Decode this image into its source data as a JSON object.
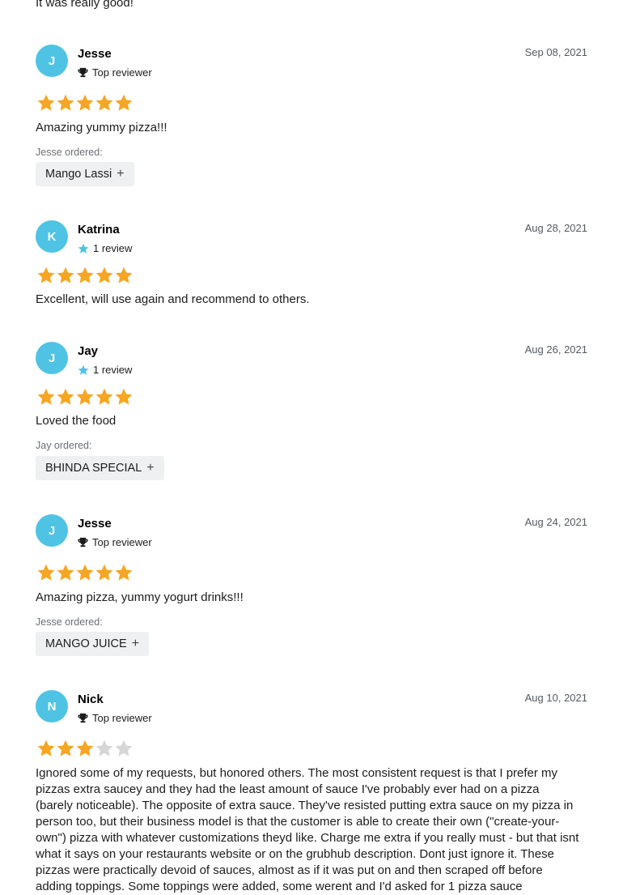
{
  "top_review_text": "It was really good!",
  "colors": {
    "avatar": "#4fc3e4",
    "star_filled": "#f6a623",
    "star_empty": "#d6d6d6"
  },
  "reviews": [
    {
      "initial": "J",
      "name": "Jesse",
      "badge_icon": "trophy-icon",
      "badge": "Top reviewer",
      "date": "Sep 08, 2021",
      "rating": 5,
      "text": "Amazing yummy pizza!!!",
      "ordered_label": "Jesse ordered:",
      "item": "Mango Lassi"
    },
    {
      "initial": "K",
      "name": "Katrina",
      "badge_icon": "star-icon",
      "badge": "1 review",
      "date": "Aug 28, 2021",
      "rating": 5,
      "text": "Excellent, will use again and recommend to others."
    },
    {
      "initial": "J",
      "name": "Jay",
      "badge_icon": "star-icon",
      "badge": "1 review",
      "date": "Aug 26, 2021",
      "rating": 5,
      "text": "Loved the food",
      "ordered_label": "Jay ordered:",
      "item": "BHINDA SPECIAL"
    },
    {
      "initial": "J",
      "name": "Jesse",
      "badge_icon": "trophy-icon",
      "badge": "Top reviewer",
      "date": "Aug 24, 2021",
      "rating": 5,
      "text": "Amazing pizza, yummy yogurt drinks!!!",
      "ordered_label": "Jesse ordered:",
      "item": "MANGO JUICE"
    },
    {
      "initial": "N",
      "name": "Nick",
      "badge_icon": "trophy-icon",
      "badge": "Top reviewer",
      "date": "Aug 10, 2021",
      "rating": 3,
      "text": "Ignored some of my requests, but honored others. The most consistent request is that I prefer my pizzas extra saucey and they had the least amount of sauce I've probably ever had on a pizza (barely noticeable). The opposite of extra sauce. They've resisted putting extra sauce on my pizza in person too, but their business model is that the customer is able to create their own (\"create-your-own\") pizza with whatever customizations theyd like. Charge me extra if you really must - but that isnt what it says on your restaurants website or on the grubhub description. Dont just ignore it. These pizzas were practically devoid of sauces, almost as if it was put on and then scraped off before adding toppings. Some toppings were added, some werent and I'd asked for 1 pizza sauce"
    }
  ]
}
